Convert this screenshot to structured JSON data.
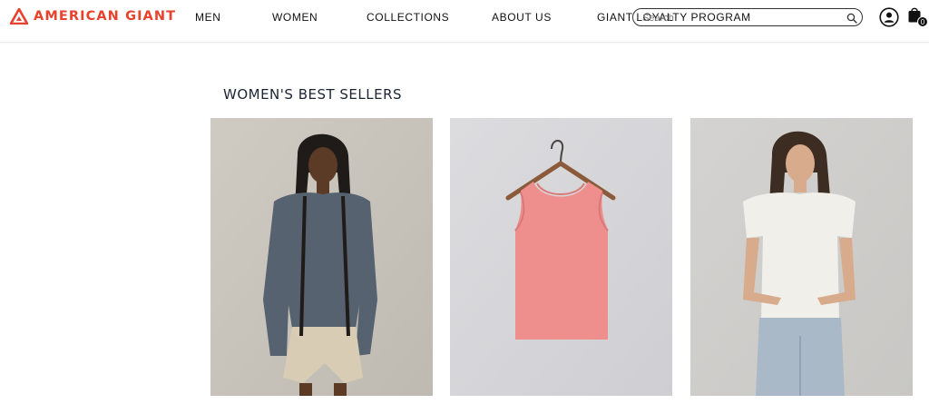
{
  "brand": {
    "name": "AMERICAN GIANT",
    "color": "#e8412c"
  },
  "nav": {
    "items": [
      {
        "label": "MEN"
      },
      {
        "label": "WOMEN"
      },
      {
        "label": "COLLECTIONS"
      },
      {
        "label": "ABOUT US"
      },
      {
        "label": "GIANT LOYALTY PROGRAM"
      }
    ]
  },
  "search": {
    "placeholder": "Search",
    "icon": "search-icon"
  },
  "cart": {
    "count": "0",
    "icon": "shopping-bag-icon"
  },
  "account": {
    "icon": "user-account-icon"
  },
  "section": {
    "title": "WOMEN'S BEST SELLERS"
  },
  "products": [
    {
      "image": "woman-in-gray-sweatshirt-and-linen-shorts",
      "background": "#c9c5bd"
    },
    {
      "image": "pink-tank-top-on-hanger",
      "background": "#d9d9dc"
    },
    {
      "image": "woman-in-white-tee-and-denim-skirt",
      "background": "#d0cfcc"
    }
  ]
}
